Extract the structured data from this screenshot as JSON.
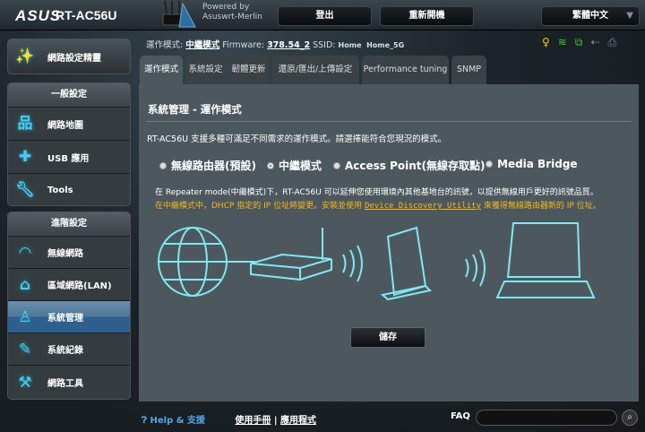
{
  "header": {
    "brand": "ASUS",
    "model": "RT-AC56U",
    "powered_by": "Powered by",
    "firmware_name": "Asuswrt-Merlin",
    "logout": "登出",
    "reboot": "重新開機",
    "language": "繁體中文"
  },
  "status": {
    "mode_label": "運作模式:",
    "mode_value": "中繼模式",
    "firmware_label": "Firmware:",
    "firmware_value": "378.54_2",
    "ssid_label": "SSID:",
    "ssid_values": "Home  Home_5G"
  },
  "sidebar": {
    "wizard": "網路設定精靈",
    "general_title": "一般設定",
    "general": [
      {
        "label": "網路地圖"
      },
      {
        "label": "USB 應用"
      },
      {
        "label": "Tools"
      }
    ],
    "advanced_title": "進階設定",
    "advanced": [
      {
        "label": "無線網路"
      },
      {
        "label": "區域網路(LAN)"
      },
      {
        "label": "系統管理"
      },
      {
        "label": "系統紀錄"
      },
      {
        "label": "網路工具"
      }
    ]
  },
  "tabs": [
    {
      "label": "運作模式"
    },
    {
      "label": "系統設定"
    },
    {
      "label": "韌體更新"
    },
    {
      "label": "還原/匯出/上傳設定"
    },
    {
      "label": "Performance tuning"
    },
    {
      "label": "SNMP"
    }
  ],
  "main": {
    "title": "系統管理 - 運作模式",
    "description": "RT-AC56U 支援多種可滿足不同需求的運作模式。請選擇能符合您現況的模式。",
    "modes": [
      {
        "label": "無線路由器(預設)",
        "selected": false
      },
      {
        "label": "中繼模式",
        "selected": true
      },
      {
        "label": "Access Point(無線存取點)",
        "selected": false
      },
      {
        "label": "Media Bridge",
        "selected": false
      }
    ],
    "info1": "在 Repeater mode(中繼模式)下，RT-AC56U 可以延伸您使用環境內其他基地台的訊號，以提供無線用戶更好的訊號品質。",
    "info2_a": "在中繼模式中，DHCP 指定的 IP 位址將變更。安裝並使用 ",
    "info2_link": "Device Discovery Utility",
    "info2_b": " 來獲得無線路由器新的 IP 位址。",
    "save": "儲存"
  },
  "footer": {
    "help": "Help & 支援",
    "manual": "使用手冊",
    "sep": " | ",
    "apps": "應用程式",
    "faq": "FAQ",
    "search_placeholder": ""
  }
}
